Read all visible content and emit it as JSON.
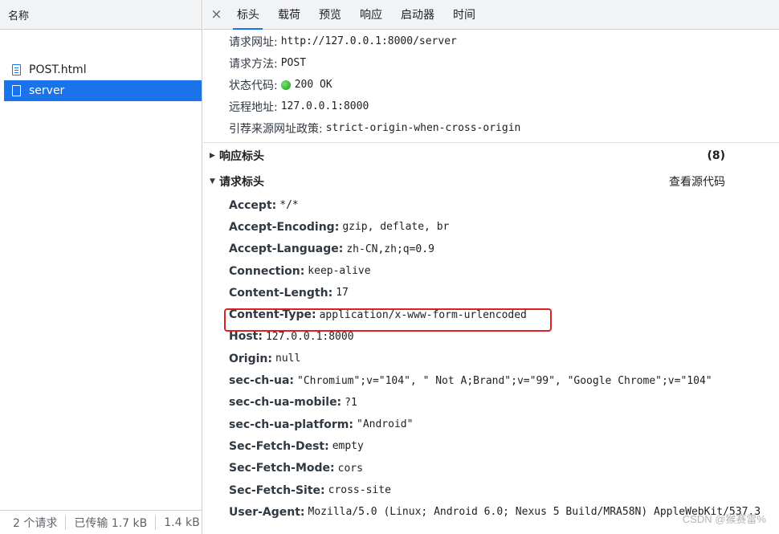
{
  "left_panel": {
    "header": "名称",
    "requests": [
      {
        "name": "POST.html",
        "selected": false
      },
      {
        "name": "server",
        "selected": true
      }
    ],
    "status": {
      "requests": "2 个请求",
      "transferred": "已传输 1.7 kB",
      "resources": "1.4 kB"
    }
  },
  "tabs": {
    "close": "×",
    "items": [
      "标头",
      "载荷",
      "预览",
      "响应",
      "启动器",
      "时间"
    ],
    "active": "标头"
  },
  "general": {
    "request_url": {
      "label": "请求网址:",
      "value": "http://127.0.0.1:8000/server"
    },
    "request_method": {
      "label": "请求方法:",
      "value": "POST"
    },
    "status_code": {
      "label": "状态代码:",
      "value": "200 OK"
    },
    "remote_address": {
      "label": "远程地址:",
      "value": "127.0.0.1:8000"
    },
    "referrer_policy": {
      "label": "引荐来源网址政策:",
      "value": "strict-origin-when-cross-origin"
    }
  },
  "response_headers": {
    "title": "响应标头",
    "count": "(8)"
  },
  "request_headers": {
    "title": "请求标头",
    "view_source": "查看源代码",
    "items": [
      {
        "name": "Accept:",
        "value": "*/*"
      },
      {
        "name": "Accept-Encoding:",
        "value": "gzip, deflate, br"
      },
      {
        "name": "Accept-Language:",
        "value": "zh-CN,zh;q=0.9"
      },
      {
        "name": "Connection:",
        "value": "keep-alive"
      },
      {
        "name": "Content-Length:",
        "value": "17"
      },
      {
        "name": "Content-Type:",
        "value": "application/x-www-form-urlencoded"
      },
      {
        "name": "Host:",
        "value": "127.0.0.1:8000"
      },
      {
        "name": "Origin:",
        "value": "null"
      },
      {
        "name": "sec-ch-ua:",
        "value": "\"Chromium\";v=\"104\", \" Not A;Brand\";v=\"99\", \"Google Chrome\";v=\"104\""
      },
      {
        "name": "sec-ch-ua-mobile:",
        "value": "?1"
      },
      {
        "name": "sec-ch-ua-platform:",
        "value": "\"Android\""
      },
      {
        "name": "Sec-Fetch-Dest:",
        "value": "empty"
      },
      {
        "name": "Sec-Fetch-Mode:",
        "value": "cors"
      },
      {
        "name": "Sec-Fetch-Site:",
        "value": "cross-site"
      },
      {
        "name": "User-Agent:",
        "value": "Mozilla/5.0 (Linux; Android 6.0; Nexus 5 Build/MRA58N) AppleWebKit/537.3"
      }
    ]
  },
  "watermark": "CSDN @猴赛雷%",
  "colors": {
    "accent": "#1a73e8",
    "highlight": "#e02020",
    "status_ok": "#0ea10e"
  }
}
